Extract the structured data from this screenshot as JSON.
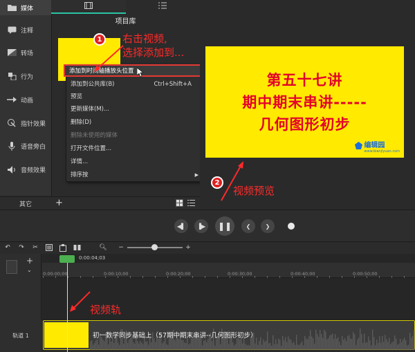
{
  "sidebar": {
    "items": [
      {
        "label": "媒体",
        "icon": "folder-icon"
      },
      {
        "label": "注释",
        "icon": "annotation-icon"
      },
      {
        "label": "转场",
        "icon": "transition-icon"
      },
      {
        "label": "行为",
        "icon": "behavior-icon"
      },
      {
        "label": "动画",
        "icon": "animation-icon"
      },
      {
        "label": "指针效果",
        "icon": "cursor-effect-icon"
      },
      {
        "label": "语音旁白",
        "icon": "microphone-icon"
      },
      {
        "label": "音频效果",
        "icon": "audio-effect-icon"
      }
    ],
    "other_label": "其它",
    "add_symbol": "+"
  },
  "bin": {
    "title": "项目库"
  },
  "context_menu": {
    "items": [
      {
        "label": "添加到时间轴播放头位置",
        "shortcut": "",
        "disabled": false
      },
      {
        "label": "添加到公共库(B)",
        "shortcut": "Ctrl+Shift+A",
        "disabled": false
      },
      {
        "label": "预览",
        "shortcut": "",
        "disabled": false
      },
      {
        "label": "更新媒体(M)...",
        "shortcut": "",
        "disabled": false
      },
      {
        "label": "删除(D)",
        "shortcut": "",
        "disabled": false
      },
      {
        "label": "删除未使用的媒体",
        "shortcut": "",
        "disabled": true
      },
      {
        "label": "打开文件位置...",
        "shortcut": "",
        "disabled": false
      },
      {
        "label": "详情...",
        "shortcut": "",
        "disabled": false
      },
      {
        "label": "排序按",
        "shortcut": "",
        "disabled": false
      }
    ]
  },
  "preview": {
    "lines": [
      "第五十七讲",
      "期中期末串讲-----",
      "几何图形初步"
    ],
    "watermark": "编辑园",
    "watermark_url": "www.bianjiyuan.com"
  },
  "timeline": {
    "playhead_time": "0:00:04;03",
    "ticks": [
      "0:00:00;00",
      "0:00:10;00",
      "0:00:20;00",
      "0:00:30;00",
      "0:00:40;00",
      "0:00:50;00"
    ],
    "track_label": "轨道 1",
    "clip_title": "初一数学同步基础上（57期中期末串讲--几何图形初步）"
  },
  "annotations": {
    "step1_badge": "1",
    "step1_text_line1": "右击视频,",
    "step1_text_line2": "选择添加到...",
    "step2_badge": "2",
    "step2_text": "视频预览",
    "track_text": "视频轨"
  },
  "colors": {
    "accent": "#2ac4a5",
    "highlight_red": "#e53935",
    "preview_bg": "#ffea00",
    "preview_text": "#e4002b",
    "playhead_green": "#4caf50"
  }
}
